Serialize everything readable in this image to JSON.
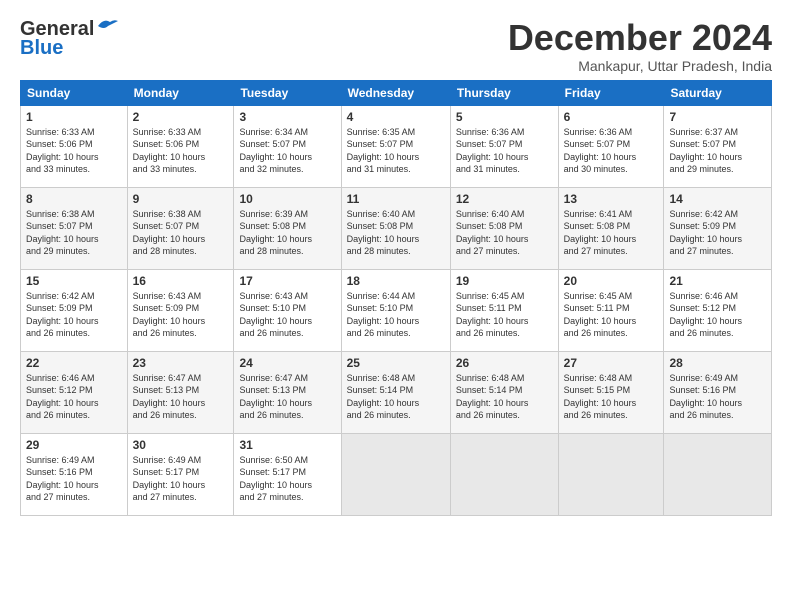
{
  "logo": {
    "line1": "General",
    "line2": "Blue"
  },
  "title": "December 2024",
  "subtitle": "Mankapur, Uttar Pradesh, India",
  "weekdays": [
    "Sunday",
    "Monday",
    "Tuesday",
    "Wednesday",
    "Thursday",
    "Friday",
    "Saturday"
  ],
  "weeks": [
    [
      {
        "day": "1",
        "info": "Sunrise: 6:33 AM\nSunset: 5:06 PM\nDaylight: 10 hours\nand 33 minutes."
      },
      {
        "day": "2",
        "info": "Sunrise: 6:33 AM\nSunset: 5:06 PM\nDaylight: 10 hours\nand 33 minutes."
      },
      {
        "day": "3",
        "info": "Sunrise: 6:34 AM\nSunset: 5:07 PM\nDaylight: 10 hours\nand 32 minutes."
      },
      {
        "day": "4",
        "info": "Sunrise: 6:35 AM\nSunset: 5:07 PM\nDaylight: 10 hours\nand 31 minutes."
      },
      {
        "day": "5",
        "info": "Sunrise: 6:36 AM\nSunset: 5:07 PM\nDaylight: 10 hours\nand 31 minutes."
      },
      {
        "day": "6",
        "info": "Sunrise: 6:36 AM\nSunset: 5:07 PM\nDaylight: 10 hours\nand 30 minutes."
      },
      {
        "day": "7",
        "info": "Sunrise: 6:37 AM\nSunset: 5:07 PM\nDaylight: 10 hours\nand 29 minutes."
      }
    ],
    [
      {
        "day": "8",
        "info": "Sunrise: 6:38 AM\nSunset: 5:07 PM\nDaylight: 10 hours\nand 29 minutes."
      },
      {
        "day": "9",
        "info": "Sunrise: 6:38 AM\nSunset: 5:07 PM\nDaylight: 10 hours\nand 28 minutes."
      },
      {
        "day": "10",
        "info": "Sunrise: 6:39 AM\nSunset: 5:08 PM\nDaylight: 10 hours\nand 28 minutes."
      },
      {
        "day": "11",
        "info": "Sunrise: 6:40 AM\nSunset: 5:08 PM\nDaylight: 10 hours\nand 28 minutes."
      },
      {
        "day": "12",
        "info": "Sunrise: 6:40 AM\nSunset: 5:08 PM\nDaylight: 10 hours\nand 27 minutes."
      },
      {
        "day": "13",
        "info": "Sunrise: 6:41 AM\nSunset: 5:08 PM\nDaylight: 10 hours\nand 27 minutes."
      },
      {
        "day": "14",
        "info": "Sunrise: 6:42 AM\nSunset: 5:09 PM\nDaylight: 10 hours\nand 27 minutes."
      }
    ],
    [
      {
        "day": "15",
        "info": "Sunrise: 6:42 AM\nSunset: 5:09 PM\nDaylight: 10 hours\nand 26 minutes."
      },
      {
        "day": "16",
        "info": "Sunrise: 6:43 AM\nSunset: 5:09 PM\nDaylight: 10 hours\nand 26 minutes."
      },
      {
        "day": "17",
        "info": "Sunrise: 6:43 AM\nSunset: 5:10 PM\nDaylight: 10 hours\nand 26 minutes."
      },
      {
        "day": "18",
        "info": "Sunrise: 6:44 AM\nSunset: 5:10 PM\nDaylight: 10 hours\nand 26 minutes."
      },
      {
        "day": "19",
        "info": "Sunrise: 6:45 AM\nSunset: 5:11 PM\nDaylight: 10 hours\nand 26 minutes."
      },
      {
        "day": "20",
        "info": "Sunrise: 6:45 AM\nSunset: 5:11 PM\nDaylight: 10 hours\nand 26 minutes."
      },
      {
        "day": "21",
        "info": "Sunrise: 6:46 AM\nSunset: 5:12 PM\nDaylight: 10 hours\nand 26 minutes."
      }
    ],
    [
      {
        "day": "22",
        "info": "Sunrise: 6:46 AM\nSunset: 5:12 PM\nDaylight: 10 hours\nand 26 minutes."
      },
      {
        "day": "23",
        "info": "Sunrise: 6:47 AM\nSunset: 5:13 PM\nDaylight: 10 hours\nand 26 minutes."
      },
      {
        "day": "24",
        "info": "Sunrise: 6:47 AM\nSunset: 5:13 PM\nDaylight: 10 hours\nand 26 minutes."
      },
      {
        "day": "25",
        "info": "Sunrise: 6:48 AM\nSunset: 5:14 PM\nDaylight: 10 hours\nand 26 minutes."
      },
      {
        "day": "26",
        "info": "Sunrise: 6:48 AM\nSunset: 5:14 PM\nDaylight: 10 hours\nand 26 minutes."
      },
      {
        "day": "27",
        "info": "Sunrise: 6:48 AM\nSunset: 5:15 PM\nDaylight: 10 hours\nand 26 minutes."
      },
      {
        "day": "28",
        "info": "Sunrise: 6:49 AM\nSunset: 5:16 PM\nDaylight: 10 hours\nand 26 minutes."
      }
    ],
    [
      {
        "day": "29",
        "info": "Sunrise: 6:49 AM\nSunset: 5:16 PM\nDaylight: 10 hours\nand 27 minutes."
      },
      {
        "day": "30",
        "info": "Sunrise: 6:49 AM\nSunset: 5:17 PM\nDaylight: 10 hours\nand 27 minutes."
      },
      {
        "day": "31",
        "info": "Sunrise: 6:50 AM\nSunset: 5:17 PM\nDaylight: 10 hours\nand 27 minutes."
      },
      {
        "day": "",
        "info": ""
      },
      {
        "day": "",
        "info": ""
      },
      {
        "day": "",
        "info": ""
      },
      {
        "day": "",
        "info": ""
      }
    ]
  ]
}
